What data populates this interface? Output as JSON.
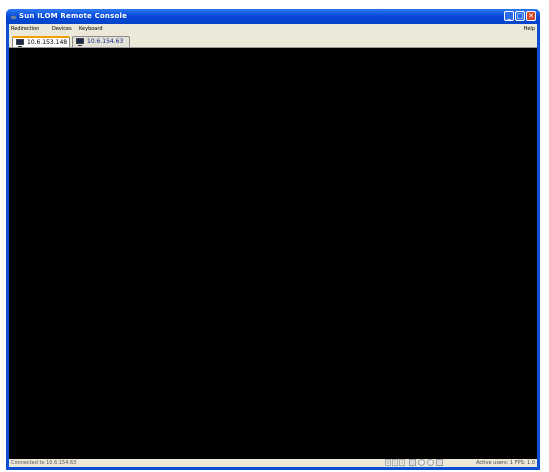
{
  "window": {
    "title": "Sun ILOM Remote Console",
    "icons": {
      "app": "java-icon",
      "minimize": "minimize-icon",
      "maximize": "maximize-icon",
      "close": "close-icon"
    }
  },
  "menu": {
    "items": [
      "Redirection",
      "Devices",
      "Keyboard"
    ],
    "help": "Help"
  },
  "tabs": [
    {
      "label": "10.6.153.148",
      "active": true
    },
    {
      "label": "10.6.154.63",
      "active": false
    }
  ],
  "status": {
    "left": "Connected to 10.6.154.63",
    "locks": [
      "N",
      "C",
      "S"
    ],
    "right": "Active users: 1 FPS: 1.0"
  },
  "colors": {
    "titlebar": "#0a4fd4",
    "screen": "#000000",
    "chrome": "#ece9d8",
    "close": "#d9472b"
  }
}
